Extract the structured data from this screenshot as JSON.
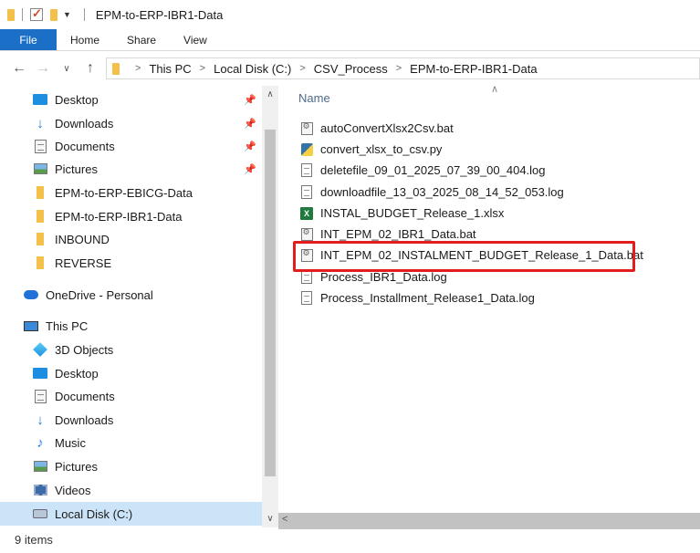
{
  "window": {
    "title": "EPM-to-ERP-IBR1-Data"
  },
  "ribbon": {
    "tabs": [
      "File",
      "Home",
      "Share",
      "View"
    ]
  },
  "address": {
    "crumbs": [
      "This PC",
      "Local Disk (C:)",
      "CSV_Process",
      "EPM-to-ERP-IBR1-Data"
    ]
  },
  "nav": {
    "quick_access": [
      {
        "label": "Desktop",
        "icon": "desktop-icon",
        "pinned": true
      },
      {
        "label": "Downloads",
        "icon": "downloads-icon",
        "pinned": true
      },
      {
        "label": "Documents",
        "icon": "documents-icon",
        "pinned": true
      },
      {
        "label": "Pictures",
        "icon": "pictures-icon",
        "pinned": true
      },
      {
        "label": "EPM-to-ERP-EBICG-Data",
        "icon": "folder-icon",
        "pinned": false
      },
      {
        "label": "EPM-to-ERP-IBR1-Data",
        "icon": "folder-icon",
        "pinned": false
      },
      {
        "label": "INBOUND",
        "icon": "folder-icon",
        "pinned": false
      },
      {
        "label": "REVERSE",
        "icon": "folder-icon",
        "pinned": false
      }
    ],
    "onedrive": "OneDrive - Personal",
    "this_pc": "This PC",
    "this_pc_items": [
      {
        "label": "3D Objects",
        "icon": "3d-objects-icon"
      },
      {
        "label": "Desktop",
        "icon": "desktop-icon"
      },
      {
        "label": "Documents",
        "icon": "documents-icon"
      },
      {
        "label": "Downloads",
        "icon": "downloads-icon"
      },
      {
        "label": "Music",
        "icon": "music-icon"
      },
      {
        "label": "Pictures",
        "icon": "pictures-icon"
      },
      {
        "label": "Videos",
        "icon": "videos-icon"
      },
      {
        "label": "Local Disk (C:)",
        "icon": "local-disk-icon",
        "selected": true
      }
    ]
  },
  "content": {
    "column_header": "Name",
    "files": [
      {
        "name": "autoConvertXlsx2Csv.bat",
        "type": "bat"
      },
      {
        "name": "convert_xlsx_to_csv.py",
        "type": "py"
      },
      {
        "name": "deletefile_09_01_2025_07_39_00_404.log",
        "type": "log"
      },
      {
        "name": "downloadfile_13_03_2025_08_14_52_053.log",
        "type": "log"
      },
      {
        "name": "INSTAL_BUDGET_Release_1.xlsx",
        "type": "xlsx"
      },
      {
        "name": "INT_EPM_02_IBR1_Data.bat",
        "type": "bat"
      },
      {
        "name": "INT_EPM_02_INSTALMENT_BUDGET_Release_1_Data.bat",
        "type": "bat",
        "highlighted": true
      },
      {
        "name": "Process_IBR1_Data.log",
        "type": "log"
      },
      {
        "name": "Process_Installment_Release1_Data.log",
        "type": "log"
      }
    ],
    "highlight_color": "#e21d1d"
  },
  "status": {
    "item_count": "9 items"
  }
}
